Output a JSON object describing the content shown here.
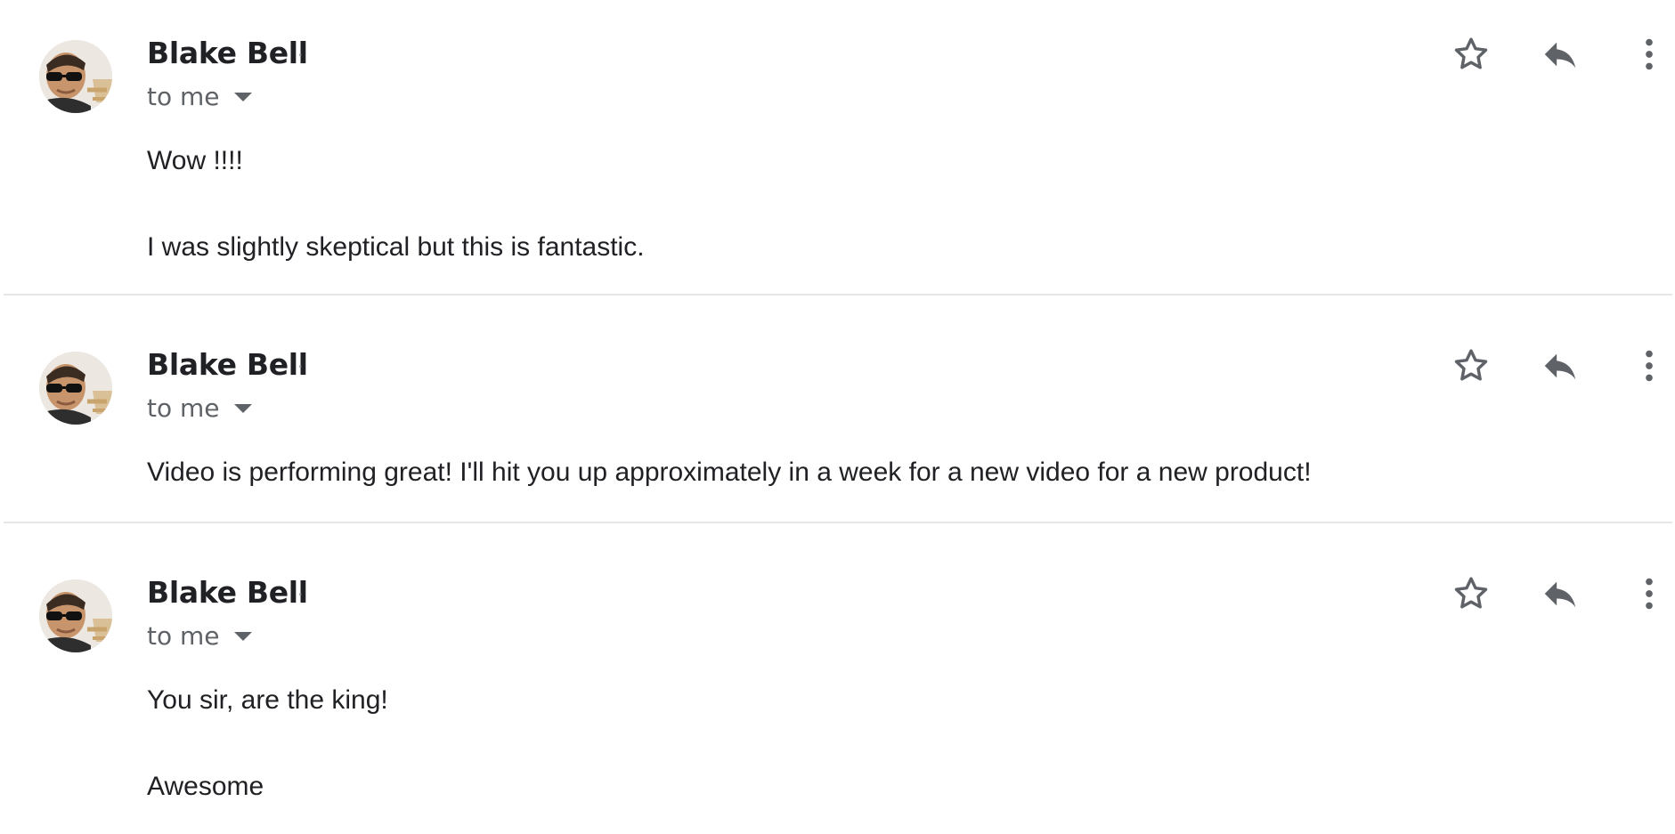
{
  "messages": [
    {
      "sender": "Blake Bell",
      "recipient": "to me",
      "body": [
        "Wow !!!!",
        "I was slightly skeptical but this is fantastic."
      ]
    },
    {
      "sender": "Blake Bell",
      "recipient": "to me",
      "body": [
        "Video is performing great! I'll hit you up approximately in a week for a new video for a new product!"
      ]
    },
    {
      "sender": "Blake Bell",
      "recipient": "to me",
      "body": [
        "You sir, are the king!",
        "Awesome"
      ]
    }
  ],
  "icons": {
    "star": "star-icon",
    "reply": "reply-icon",
    "more": "more-vert-icon",
    "recipient_caret": "caret-down-icon"
  },
  "colors": {
    "sender": "#202124",
    "secondary": "#5f6368",
    "icon": "#5f6368",
    "divider": "#e6e6e6",
    "avatar_logo": "#d7b98a"
  }
}
